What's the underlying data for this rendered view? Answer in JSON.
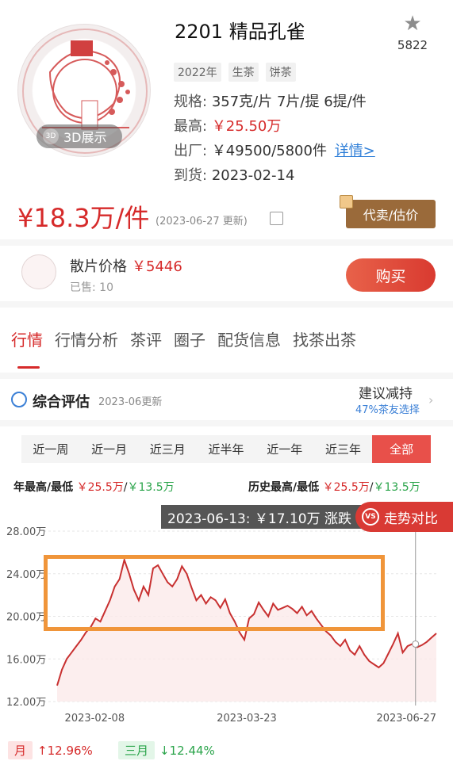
{
  "product": {
    "title": "2201 精品孔雀",
    "favorite_count": "5822",
    "tags": [
      "2022年",
      "生茶",
      "饼茶"
    ],
    "spec_label": "规格:",
    "spec_value": "357克/片 7片/提 6提/件",
    "high_label": "最高:",
    "high_value": "￥25.50万",
    "factory_label": "出厂:",
    "factory_value": "￥49500/5800件",
    "factory_link": "详情>",
    "arrival_label": "到货:",
    "arrival_value": "2023-02-14",
    "btn_3d": "3D展示"
  },
  "price": {
    "value": "¥18.3万/件",
    "update": "(2023-06-27 更新)",
    "agent_button": "代卖/估价"
  },
  "loose": {
    "title": "散片价格",
    "price": "￥5446",
    "sold": "已售: 10",
    "buy_button": "购买"
  },
  "tabs": [
    "行情",
    "行情分析",
    "茶评",
    "圈子",
    "配货信息",
    "找茶出茶"
  ],
  "evaluation": {
    "title": "综合评估",
    "date": "2023-06更新",
    "advice": "建议减持",
    "advice_sub": "47%茶友选择"
  },
  "ranges": [
    "近一周",
    "近一月",
    "近三月",
    "近半年",
    "近一年",
    "近三年",
    "全部"
  ],
  "stats": {
    "year_label": "年最高/最低",
    "year_high": "￥25.5万",
    "year_low": "￥13.5万",
    "hist_label": "历史最高/最低",
    "hist_high": "￥25.5万",
    "hist_low": "￥13.5万"
  },
  "tooltip": "2023-06-13: ￥17.10万  涨跌",
  "compare_button": "走势对比",
  "chart_data": {
    "type": "area",
    "x_ticks": [
      "2023-02-08",
      "2023-03-23",
      "2023-06-27"
    ],
    "y_ticks": [
      "12.00万",
      "16.00万",
      "20.00万",
      "24.00万",
      "28.00万"
    ],
    "ylim": [
      12,
      28
    ],
    "series": [
      {
        "x_index": [
          0,
          1,
          2,
          3,
          4,
          5,
          6,
          7,
          8,
          9,
          10,
          11,
          12,
          13,
          14,
          15,
          16,
          17,
          18,
          19,
          20,
          21,
          22,
          23,
          24,
          25,
          26,
          27,
          28,
          29,
          30,
          31,
          32,
          33,
          34,
          35,
          36,
          37,
          38,
          39,
          40,
          41,
          42,
          43,
          44,
          45,
          46,
          47,
          48,
          49,
          50,
          51,
          52,
          53,
          54,
          55,
          56,
          57,
          58,
          59,
          60,
          61,
          62,
          63,
          64,
          65,
          66,
          67,
          68,
          69,
          70,
          71,
          72,
          73,
          74,
          75,
          76,
          77,
          78,
          79
        ],
        "values": [
          13.5,
          15.0,
          16.0,
          16.6,
          17.2,
          17.8,
          18.5,
          19.0,
          19.8,
          19.5,
          20.5,
          21.5,
          22.8,
          23.5,
          25.3,
          24.0,
          22.5,
          21.5,
          22.8,
          22.0,
          24.5,
          24.8,
          24.0,
          23.2,
          22.8,
          23.5,
          24.7,
          24.0,
          22.7,
          21.5,
          22.0,
          21.2,
          21.8,
          21.5,
          20.8,
          21.6,
          20.3,
          19.5,
          18.5,
          17.8,
          19.8,
          20.2,
          21.3,
          20.6,
          20.0,
          21.2,
          20.6,
          20.8,
          21.0,
          20.7,
          20.3,
          20.9,
          20.1,
          20.5,
          19.8,
          19.2,
          18.6,
          18.2,
          17.6,
          17.2,
          17.8,
          16.8,
          16.4,
          17.2,
          16.4,
          15.8,
          15.5,
          15.2,
          15.6,
          16.5,
          17.4,
          18.4,
          16.6,
          17.2,
          17.4,
          17.1,
          17.3,
          17.6,
          18.0,
          18.4
        ]
      }
    ]
  },
  "changes": {
    "month_label": "月",
    "month_value": "↑12.96%",
    "quarter_label": "三月",
    "quarter_value": "↓12.44%"
  },
  "colors": {
    "accent_red": "#d62a2a",
    "green": "#2aa44a",
    "link_blue": "#2f7fd8",
    "highlight_orange": "#f0953a",
    "agent_brown": "#9a6a3a"
  }
}
